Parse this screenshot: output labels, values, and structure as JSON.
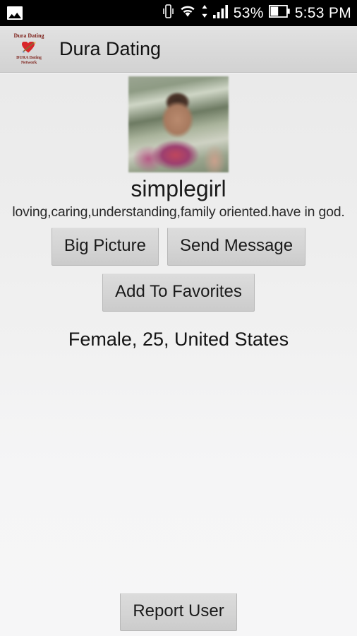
{
  "status_bar": {
    "notification_icon": "gallery-icon",
    "vibrate_icon": "vibrate-icon",
    "wifi_icon": "wifi-icon",
    "data_arrows_icon": "data-transfer-arrows-icon",
    "signal_icon": "cellular-signal-icon",
    "battery_percent": "53%",
    "battery_icon": "battery-icon",
    "time": "5:53 PM"
  },
  "action_bar": {
    "title": "Dura Dating",
    "logo": {
      "top_text": "Dura Dating",
      "bottom_text_line1": "DURA Dating",
      "bottom_text_line2": "Network",
      "icon": "heart-with-arrow-icon",
      "heart_color": "#d9262a",
      "text_color": "#7c1f18"
    }
  },
  "profile": {
    "photo_alt": "profile-photo",
    "username": "simplegirl",
    "bio": "loving,caring,understanding,family oriented.have in god.",
    "demographics": "Female, 25, United States",
    "gender": "Female",
    "age": "25",
    "country": "United States"
  },
  "actions": {
    "big_picture": "Big Picture",
    "send_message": "Send Message",
    "add_to_favorites": "Add To Favorites",
    "report_user": "Report User"
  },
  "colors": {
    "status_bar_bg": "#000000",
    "action_bar_bg": "#d9d9d9",
    "content_bg": "#f1f1f1",
    "button_bg": "#d3d3d3",
    "text_primary": "#1a1a1a"
  }
}
